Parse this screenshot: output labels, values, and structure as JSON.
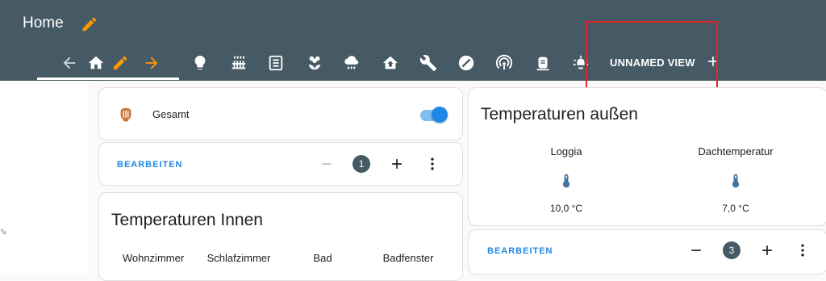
{
  "header": {
    "title": "Home",
    "active_view": "UNNAMED VIEW",
    "tab_icons": [
      "arrow-left-icon",
      "home-icon",
      "pencil-icon",
      "arrow-right-icon",
      "lightbulb-icon",
      "radiator-icon",
      "heat-pump-icon",
      "flower-icon",
      "weather-cloud-rain-icon",
      "home-heat-icon",
      "wrench-icon",
      "gauge-icon",
      "signal-icon",
      "battery-icon",
      "ceiling-light-icon",
      "plus-icon"
    ]
  },
  "colors": {
    "header_bg": "#455a64",
    "accent_orange": "#ff9800",
    "accent_blue": "#1e88e5",
    "highlight_red": "#e0242a"
  },
  "gesamt_card": {
    "label": "Gesamt",
    "toggle_on": true
  },
  "edit_bar_left": {
    "edit_label": "BEARBEITEN",
    "count": "1"
  },
  "innen_card": {
    "title": "Temperaturen Innen",
    "columns": [
      "Wohnzimmer",
      "Schlafzimmer",
      "Bad",
      "Badfenster"
    ]
  },
  "aussen_card": {
    "title": "Temperaturen außen",
    "sensors": [
      {
        "name": "Loggia",
        "value": "10,0 °C"
      },
      {
        "name": "Dachtemperatur",
        "value": "7,0 °C"
      }
    ]
  },
  "edit_bar_right": {
    "edit_label": "BEARBEITEN",
    "count": "3"
  }
}
